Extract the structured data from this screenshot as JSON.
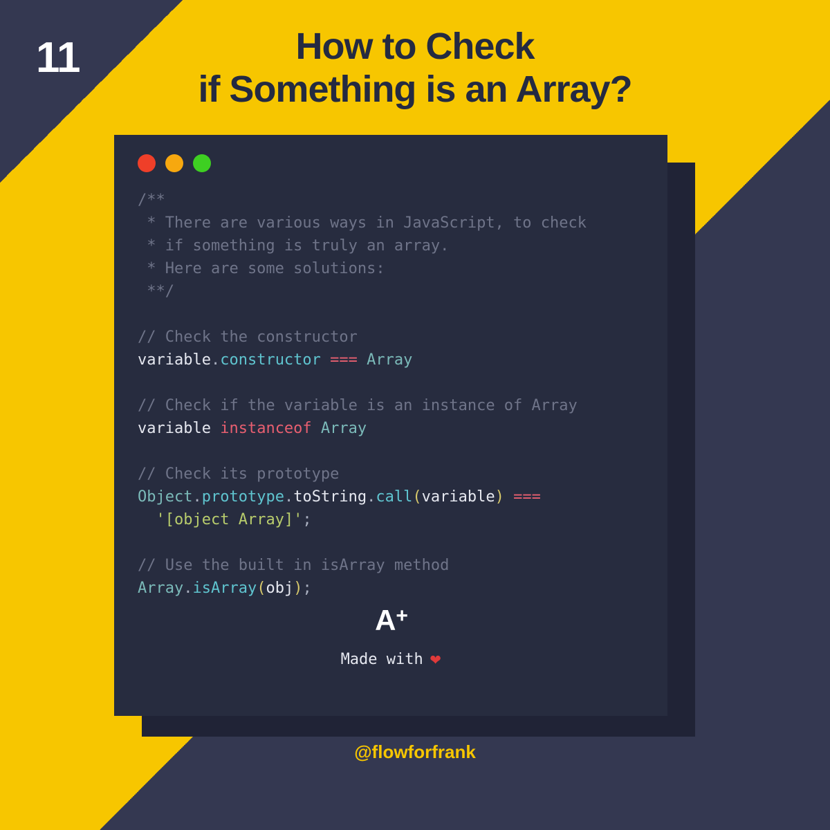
{
  "slide_number": "11",
  "title_line1": "How to Check",
  "title_line2": "if Something is an Array?",
  "code": {
    "block_comment": [
      "/**",
      " * There are various ways in JavaScript, to check",
      " * if something is truly an array.",
      " * Here are some solutions:",
      " **/"
    ],
    "sec1_comment": "// Check the constructor",
    "sec1_var": "variable",
    "sec1_dot": ".",
    "sec1_prop": "constructor",
    "sec1_op": "===",
    "sec1_type": "Array",
    "sec2_comment": "// Check if the variable is an instance of Array",
    "sec2_var": "variable",
    "sec2_kw": "instanceof",
    "sec2_type": "Array",
    "sec3_comment": "// Check its prototype",
    "sec3_obj": "Object",
    "sec3_proto": "prototype",
    "sec3_tostr": "toString",
    "sec3_call": "call",
    "sec3_arg": "variable",
    "sec3_op": "===",
    "sec3_str": "'[object Array]'",
    "sec3_semi": ";",
    "sec4_comment": "// Use the built in isArray method",
    "sec4_arr": "Array",
    "sec4_fn": "isArray",
    "sec4_arg": "obj",
    "sec4_semi": ";"
  },
  "badge_logo_a": "A",
  "badge_logo_plus": "+",
  "made_with_label": "Made with",
  "heart_glyph": "❤",
  "handle": "@flowforfrank"
}
